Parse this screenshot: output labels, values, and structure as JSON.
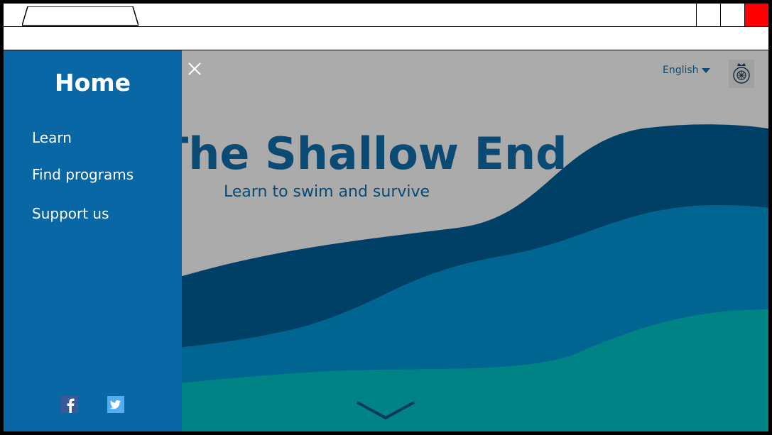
{
  "window": {
    "tab_title": "",
    "address": ""
  },
  "page": {
    "hero_title": "The Shallow End",
    "hero_subtitle": "Learn to swim and survive",
    "language": "English"
  },
  "menu": {
    "home_label": "Home",
    "items": [
      {
        "label": "Learn"
      },
      {
        "label": "Find programs"
      },
      {
        "label": "Support us"
      }
    ]
  },
  "social": {
    "facebook_icon": "facebook-icon",
    "twitter_icon": "twitter-icon"
  },
  "colors": {
    "sidebar": "#0a67a6",
    "background": "#ababab",
    "wave_dark": "#004066",
    "wave_mid": "#006691",
    "wave_teal": "#008384",
    "text_dark": "#0b4a73",
    "close_button": "#ff0000"
  }
}
